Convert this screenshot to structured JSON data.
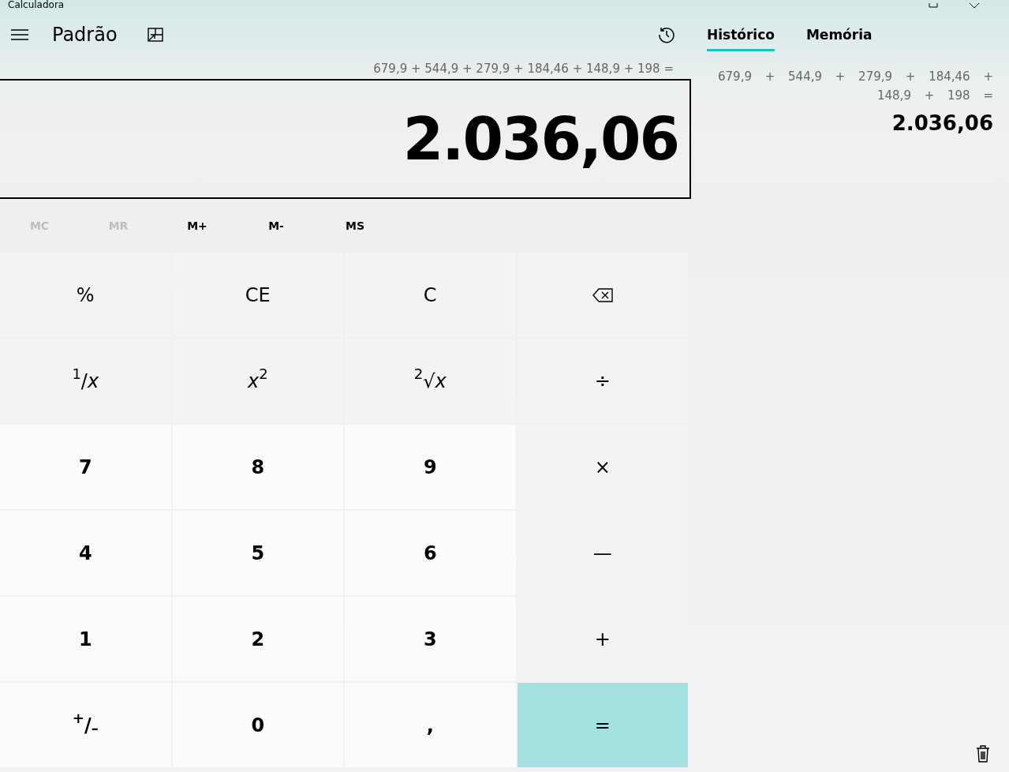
{
  "window": {
    "title": "Calculadora"
  },
  "header": {
    "mode": "Padrão"
  },
  "expression": "679,9 + 544,9 + 279,9 + 184,46 + 148,9 + 198 =",
  "display": "2.036,06",
  "memory_buttons": [
    {
      "label": "MC",
      "disabled": true
    },
    {
      "label": "MR",
      "disabled": true
    },
    {
      "label": "M+",
      "disabled": false
    },
    {
      "label": "M-",
      "disabled": false
    },
    {
      "label": "MS",
      "disabled": false
    }
  ],
  "keys": [
    {
      "kind": "function",
      "label": "%"
    },
    {
      "kind": "function",
      "label": "CE"
    },
    {
      "kind": "function",
      "label": "C"
    },
    {
      "kind": "backspace"
    },
    {
      "kind": "function",
      "label": "$^{1}$/*x*"
    },
    {
      "kind": "function",
      "label": "*x*$^{2}$"
    },
    {
      "kind": "function",
      "label": "$^{2}$√*x*"
    },
    {
      "kind": "function",
      "label": "÷"
    },
    {
      "kind": "digit",
      "label": "7"
    },
    {
      "kind": "digit",
      "label": "8"
    },
    {
      "kind": "digit",
      "label": "9"
    },
    {
      "kind": "function",
      "label": "×"
    },
    {
      "kind": "digit",
      "label": "4"
    },
    {
      "kind": "digit",
      "label": "5"
    },
    {
      "kind": "digit",
      "label": "6"
    },
    {
      "kind": "function",
      "label": "—"
    },
    {
      "kind": "digit",
      "label": "1"
    },
    {
      "kind": "digit",
      "label": "2"
    },
    {
      "kind": "digit",
      "label": "3"
    },
    {
      "kind": "function",
      "label": "+"
    },
    {
      "kind": "digit",
      "label": "$^{+}$/$_{–}$"
    },
    {
      "kind": "digit",
      "label": "0"
    },
    {
      "kind": "digit",
      "label": ","
    },
    {
      "kind": "equals",
      "label": "="
    }
  ],
  "panel": {
    "tabs": [
      {
        "label": "Histórico",
        "selected": true
      },
      {
        "label": "Memória",
        "selected": false
      }
    ],
    "history": [
      {
        "expression": "679,9 + 544,9 + 279,9 + 184,46 + 148,9 + 198 =",
        "result": "2.036,06"
      }
    ]
  }
}
